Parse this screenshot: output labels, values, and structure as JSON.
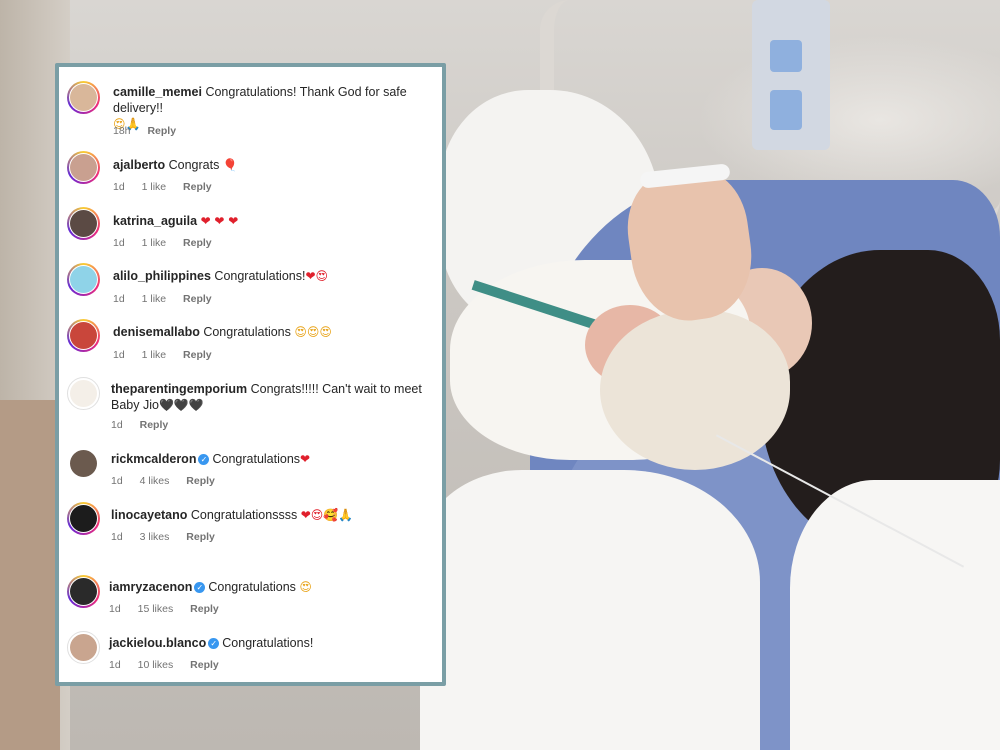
{
  "comments": [
    {
      "username": "camille_memei",
      "verified": false,
      "text": "Congratulations! Thank God for safe delivery!!",
      "emojis": "😍🙏",
      "time": "18h",
      "likes": "",
      "reply": "Reply",
      "avatar_color": "#d9b79a"
    },
    {
      "username": "ajalberto",
      "verified": false,
      "text": "Congrats",
      "emojis": "🎈",
      "time": "1d",
      "likes": "1 like",
      "reply": "Reply",
      "avatar_color": "#c9a090"
    },
    {
      "username": "katrina_aguila",
      "verified": false,
      "text": "",
      "emojis": "❤ ❤ ❤",
      "time": "1d",
      "likes": "1 like",
      "reply": "Reply",
      "avatar_color": "#5b4a44"
    },
    {
      "username": "alilo_philippines",
      "verified": false,
      "text": "Congratulations!",
      "emojis": "❤😍",
      "time": "1d",
      "likes": "1 like",
      "reply": "Reply",
      "avatar_color": "#8fd3e8"
    },
    {
      "username": "denisemallabo",
      "verified": false,
      "text": "Congratulations",
      "emojis": "😍😍😍",
      "time": "1d",
      "likes": "1 like",
      "reply": "Reply",
      "avatar_color": "#c9463b"
    },
    {
      "username": "theparentingemporium",
      "verified": false,
      "text": "Congrats!!!!! Can't wait to meet Baby Jio",
      "emojis": "🖤🖤🖤",
      "time": "1d",
      "likes": "",
      "reply": "Reply",
      "avatar_color": "#f4efe8"
    },
    {
      "username": "rickmcalderon",
      "verified": true,
      "text": "Congratulations",
      "emojis": "❤",
      "time": "1d",
      "likes": "4 likes",
      "reply": "Reply",
      "avatar_color": "#6b5a4e"
    },
    {
      "username": "linocayetano",
      "verified": false,
      "text": "Congratulationssss",
      "emojis": "❤😍🥰🙏",
      "time": "1d",
      "likes": "3 likes",
      "reply": "Reply",
      "avatar_color": "#1c1c1c"
    },
    {
      "username": "iamryzacenon",
      "verified": true,
      "text": "Congratulations",
      "emojis": "😍",
      "time": "1d",
      "likes": "15 likes",
      "reply": "Reply",
      "avatar_color": "#2a2a2a"
    },
    {
      "username": "jackielou.blanco",
      "verified": true,
      "text": "Congratulations!",
      "emojis": "",
      "time": "1d",
      "likes": "10 likes",
      "reply": "Reply",
      "avatar_color": "#c9a58f"
    }
  ]
}
